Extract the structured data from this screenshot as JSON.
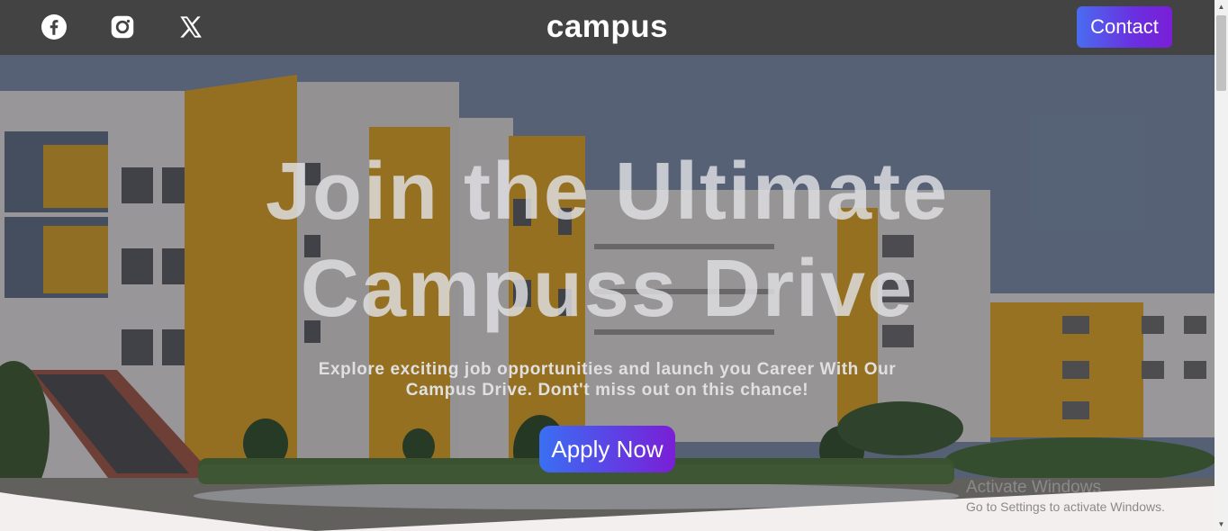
{
  "navbar": {
    "brand": "campus",
    "contact_label": "Contact",
    "social_icons": [
      "facebook-icon",
      "instagram-icon",
      "x-icon"
    ]
  },
  "hero": {
    "headline_line1": "Join the Ultimate",
    "headline_line2": "Campuss Drive",
    "subtext_line1": "Explore exciting job opportunities and launch you Career With Our",
    "subtext_line2": "Campus Drive. Dont't miss out on this chance!",
    "apply_label": "Apply Now"
  },
  "os_watermark": {
    "title": "Activate Windows",
    "subtitle": "Go to Settings to activate Windows."
  },
  "colors": {
    "navbar": "#434343",
    "button_gradient_start": "#3a6ff2",
    "button_gradient_end": "#7a1fd6",
    "page_bg": "#f3efef"
  }
}
